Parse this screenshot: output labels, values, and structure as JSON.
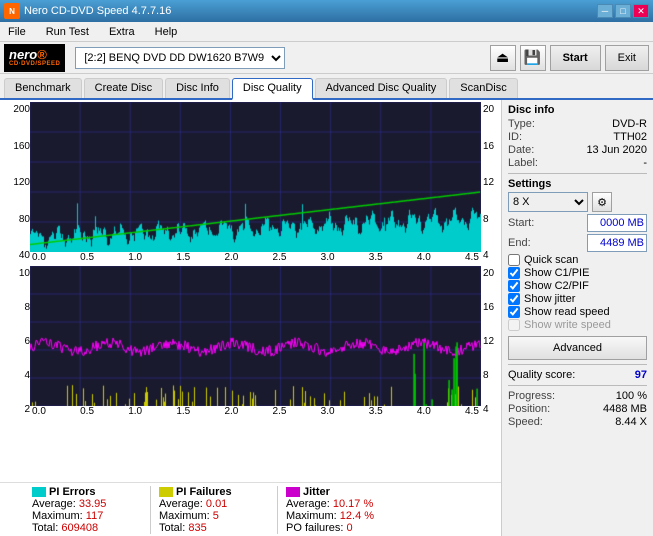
{
  "titlebar": {
    "title": "Nero CD-DVD Speed 4.7.7.16",
    "min_label": "–",
    "max_label": "□",
    "close_label": "✕"
  },
  "menubar": {
    "items": [
      "File",
      "Run Test",
      "Extra",
      "Help"
    ]
  },
  "toolbar": {
    "drive_label": "[2:2]  BENQ DVD DD DW1620 B7W9",
    "start_label": "Start",
    "exit_label": "Exit"
  },
  "tabs": {
    "items": [
      "Benchmark",
      "Create Disc",
      "Disc Info",
      "Disc Quality",
      "Advanced Disc Quality",
      "ScanDisc"
    ],
    "active": "Disc Quality"
  },
  "disc_info": {
    "section_title": "Disc info",
    "type_label": "Type:",
    "type_value": "DVD-R",
    "id_label": "ID:",
    "id_value": "TTH02",
    "date_label": "Date:",
    "date_value": "13 Jun 2020",
    "label_label": "Label:",
    "label_value": "-"
  },
  "settings": {
    "section_title": "Settings",
    "speed_value": "8 X",
    "start_label": "Start:",
    "start_value": "0000 MB",
    "end_label": "End:",
    "end_value": "4489 MB"
  },
  "checkboxes": {
    "quick_scan": {
      "label": "Quick scan",
      "checked": false
    },
    "show_c1pie": {
      "label": "Show C1/PIE",
      "checked": true
    },
    "show_c2pif": {
      "label": "Show C2/PIF",
      "checked": true
    },
    "show_jitter": {
      "label": "Show jitter",
      "checked": true
    },
    "show_read_speed": {
      "label": "Show read speed",
      "checked": true
    },
    "show_write_speed": {
      "label": "Show write speed",
      "checked": false,
      "disabled": true
    }
  },
  "advanced_btn": "Advanced",
  "quality": {
    "score_label": "Quality score:",
    "score_value": "97"
  },
  "progress": {
    "progress_label": "Progress:",
    "progress_value": "100 %",
    "position_label": "Position:",
    "position_value": "4488 MB",
    "speed_label": "Speed:",
    "speed_value": "8.44 X"
  },
  "legend": {
    "pi_errors": {
      "label": "PI Errors",
      "color": "#00cccc",
      "avg_label": "Average:",
      "avg_value": "33.95",
      "max_label": "Maximum:",
      "max_value": "117",
      "total_label": "Total:",
      "total_value": "609408"
    },
    "pi_failures": {
      "label": "PI Failures",
      "color": "#cccc00",
      "avg_label": "Average:",
      "avg_value": "0.01",
      "max_label": "Maximum:",
      "max_value": "5",
      "total_label": "Total:",
      "total_value": "835"
    },
    "jitter": {
      "label": "Jitter",
      "color": "#cc00cc",
      "avg_label": "Average:",
      "avg_value": "10.17 %",
      "max_label": "Maximum:",
      "max_value": "12.4 %",
      "po_label": "PO failures:",
      "po_value": "0"
    }
  },
  "chart_top": {
    "y_labels_left": [
      "200",
      "160",
      "120",
      "80",
      "40"
    ],
    "y_labels_right": [
      "20",
      "16",
      "12",
      "8",
      "4"
    ],
    "x_labels": [
      "0.0",
      "0.5",
      "1.0",
      "1.5",
      "2.0",
      "2.5",
      "3.0",
      "3.5",
      "4.0",
      "4.5"
    ]
  },
  "chart_bottom": {
    "y_labels_left": [
      "10",
      "8",
      "6",
      "4",
      "2"
    ],
    "y_labels_right": [
      "20",
      "16",
      "12",
      "8",
      "4"
    ],
    "x_labels": [
      "0.0",
      "0.5",
      "1.0",
      "1.5",
      "2.0",
      "2.5",
      "3.0",
      "3.5",
      "4.0",
      "4.5"
    ]
  }
}
